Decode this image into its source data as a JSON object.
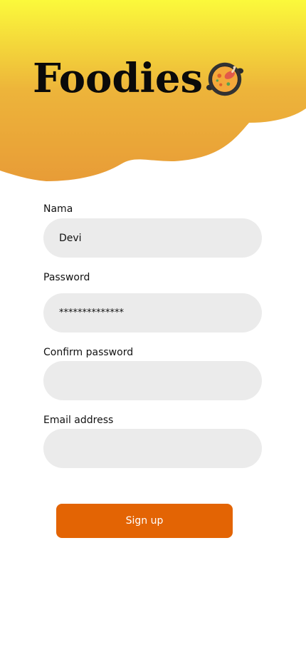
{
  "brand": {
    "title": "Foodies",
    "icon": "paella-pan-icon"
  },
  "colors": {
    "header_top": "#fbf93b",
    "header_bottom": "#e89c37",
    "input_bg": "#ebebeb",
    "button_bg": "#e36404",
    "button_text": "#ffffff"
  },
  "form": {
    "name": {
      "label": "Nama",
      "value": "Devi"
    },
    "password": {
      "label": "Password",
      "value": "**************"
    },
    "confirm_password": {
      "label": "Confirm password",
      "value": ""
    },
    "email": {
      "label": "Email address",
      "value": ""
    },
    "submit_label": "Sign up"
  }
}
